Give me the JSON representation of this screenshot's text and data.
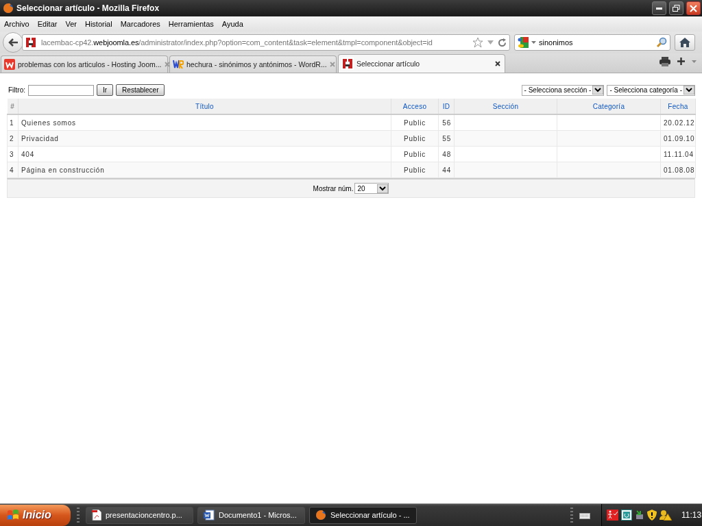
{
  "window": {
    "title": "Seleccionar artículo - Mozilla Firefox"
  },
  "menu": [
    "Archivo",
    "Editar",
    "Ver",
    "Historial",
    "Marcadores",
    "Herramientas",
    "Ayuda"
  ],
  "address": {
    "prefix": "lacembac-cp42.",
    "domain": "webjoomla.es",
    "path": "/administrator/index.php?option=com_content&task=element&tmpl=component&object=id"
  },
  "search": {
    "value": "sinonimos"
  },
  "tabs": [
    {
      "label": "problemas con los articulos - Hosting Joom...",
      "selected": false,
      "kind": "hosting"
    },
    {
      "label": "hechura - sinónimos y antónimos - WordR...",
      "selected": false,
      "kind": "wordreference"
    },
    {
      "label": "Seleccionar artículo",
      "selected": true,
      "kind": "joomla"
    }
  ],
  "filter": {
    "label": "Filtro:",
    "buttons": [
      "Ir",
      "Restablecer"
    ],
    "selects": [
      "- Selecciona sección -",
      "- Selecciona categoría -"
    ]
  },
  "table": {
    "columns": [
      "#",
      "Título",
      "Acceso",
      "ID",
      "Sección",
      "Categoría",
      "Fecha"
    ],
    "rows": [
      [
        "1",
        "Quienes somos",
        "Public",
        "56",
        "",
        "",
        "20.02.12"
      ],
      [
        "2",
        "Privacidad",
        "Public",
        "55",
        "",
        "",
        "01.09.10"
      ],
      [
        "3",
        "404",
        "Public",
        "48",
        "",
        "",
        "11.11.04"
      ],
      [
        "4",
        "Página en construcción",
        "Public",
        "44",
        "",
        "",
        "01.08.08"
      ]
    ]
  },
  "footer": {
    "label": "Mostrar núm.",
    "value": "20"
  },
  "taskbar": {
    "start": "Inicio",
    "tasks": [
      {
        "label": "presentacioncentro.p...",
        "selected": false,
        "kind": "pdf"
      },
      {
        "label": "Documento1 - Micros...",
        "selected": false,
        "kind": "word"
      },
      {
        "label": "Seleccionar artículo - ...",
        "selected": true,
        "kind": "firefox"
      }
    ],
    "clock": "11:13"
  }
}
